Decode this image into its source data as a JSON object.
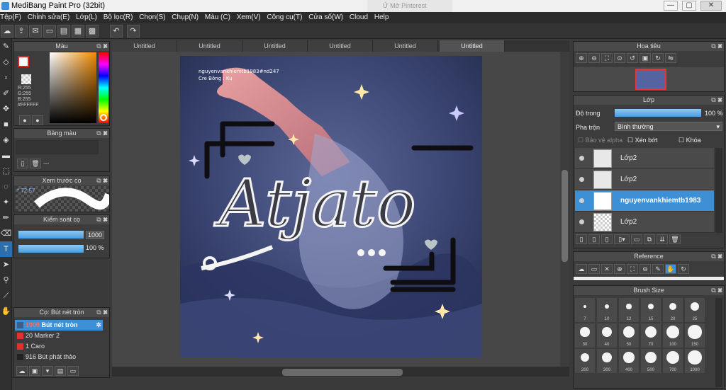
{
  "window": {
    "title": "MediBang Paint Pro (32bit)",
    "bg_tab": "Ứ Mở Pinterest",
    "controls": {
      "min": "—",
      "max": "▢",
      "close": "✕"
    }
  },
  "menu": [
    "Tệp(F)",
    "Chỉnh sửa(E)",
    "Lớp(L)",
    "Bộ lọc(R)",
    "Chọn(S)",
    "Chụp(N)",
    "Màu (C)",
    "Xem(V)",
    "Công cụ(T)",
    "Cửa số(W)",
    "Cloud",
    "Help"
  ],
  "tabs": [
    "Untitled",
    "Untitled",
    "Untitled",
    "Untitled",
    "Untitled",
    "Untitled"
  ],
  "color_panel": {
    "title": "Màu",
    "r": "R:255",
    "g": "G:255",
    "b": "B:255",
    "hex": "#FFFFFF"
  },
  "palette_panel": {
    "title": "Bảng màu",
    "value": "---"
  },
  "preview_panel": {
    "title": "Xem trước cọ",
    "size": "72.57"
  },
  "brush_control": {
    "title": "Kiểm soát cọ",
    "size": "1000",
    "opacity": "100 %"
  },
  "brush_list": {
    "title": "Cọ: Bút nét tròn",
    "items": [
      {
        "size": "1000",
        "name": "Bút nét tròn",
        "color": "#3b5f8a",
        "selected": true
      },
      {
        "size": "20",
        "name": "Marker 2",
        "color": "#d33",
        "selected": false
      },
      {
        "size": "1",
        "name": "Caro",
        "color": "#d33",
        "selected": false
      },
      {
        "size": "916",
        "name": "Bút phát thảo",
        "color": "#222",
        "selected": false
      }
    ]
  },
  "navigator": {
    "title": "Hoa tiêu"
  },
  "layers": {
    "title": "Lớp",
    "opacity_label": "Độ trong",
    "opacity_value": "100 %",
    "opacity_fraction": 1.0,
    "blend_label": "Pha trộn",
    "blend_value": "Bình thường",
    "protect_alpha": "Bảo vệ alpha",
    "clip": "Xén bớt",
    "lock": "Khóa",
    "items": [
      {
        "name": "Lớp2",
        "selected": false
      },
      {
        "name": "Lớp2",
        "selected": false
      },
      {
        "name": "nguyenvankhiemtb1983",
        "selected": true
      },
      {
        "name": "Lớp2",
        "selected": false
      }
    ]
  },
  "reference": {
    "title": "Reference"
  },
  "brush_size": {
    "title": "Brush Size",
    "sizes": [
      "7",
      "10",
      "12",
      "15",
      "20",
      "25",
      "30",
      "40",
      "50",
      "70",
      "100",
      "150",
      "200",
      "300",
      "400",
      "500",
      "700",
      "1000"
    ]
  },
  "artwork": {
    "watermark1": "nguyenvankhiemtb1983#nd247",
    "watermark2": "Cre Bông : Ku",
    "lettering": "Atjato"
  },
  "colors": {
    "accent": "#3d8fd6",
    "panel": "#3c3c3c",
    "canvas_bg": "#474747"
  }
}
